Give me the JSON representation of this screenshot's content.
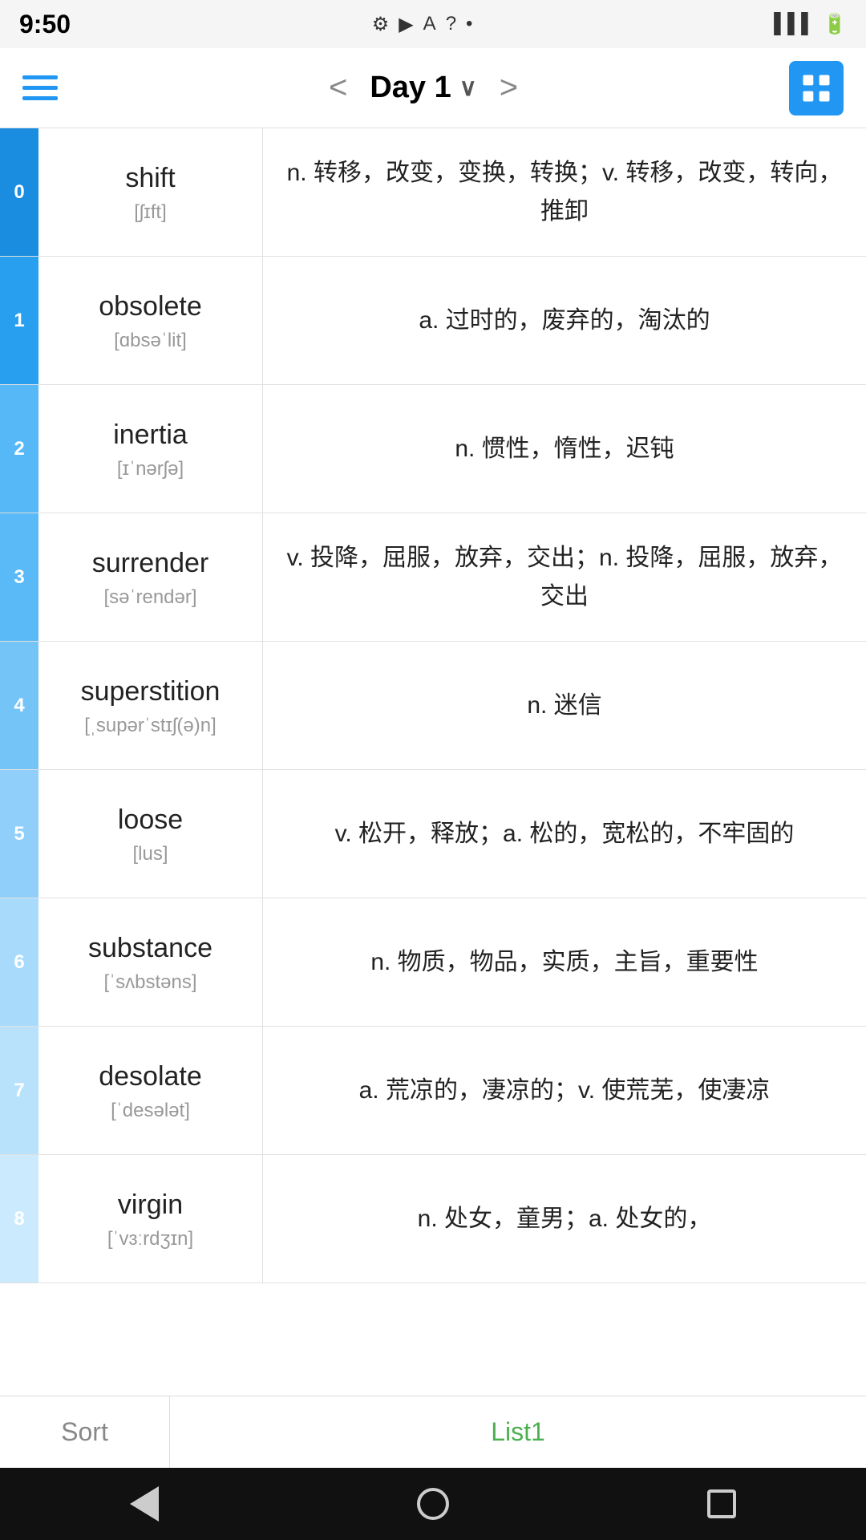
{
  "statusBar": {
    "time": "9:50",
    "icons": [
      "⚙",
      "▶",
      "A",
      "?",
      "•"
    ]
  },
  "navBar": {
    "prevLabel": "<",
    "nextLabel": ">",
    "title": "Day 1",
    "chevron": "∨"
  },
  "words": [
    {
      "index": "0",
      "english": "shift",
      "phonetic": "[ʃɪft]",
      "definition": "n. 转移，改变，变换，转换；v. 转移，改变，转向，推卸"
    },
    {
      "index": "1",
      "english": "obsolete",
      "phonetic": "[ɑbsəˈlit]",
      "definition": "a. 过时的，废弃的，淘汰的"
    },
    {
      "index": "2",
      "english": "inertia",
      "phonetic": "[ɪˈnərʃə]",
      "definition": "n. 惯性，惰性，迟钝"
    },
    {
      "index": "3",
      "english": "surrender",
      "phonetic": "[səˈrendər]",
      "definition": "v. 投降，屈服，放弃，交出；n. 投降，屈服，放弃，交出"
    },
    {
      "index": "4",
      "english": "superstition",
      "phonetic": "[ˌsupərˈstɪʃ(ə)n]",
      "definition": "n. 迷信"
    },
    {
      "index": "5",
      "english": "loose",
      "phonetic": "[lus]",
      "definition": "v. 松开，释放；a. 松的，宽松的，不牢固的"
    },
    {
      "index": "6",
      "english": "substance",
      "phonetic": "[ˈsʌbstəns]",
      "definition": "n. 物质，物品，实质，主旨，重要性"
    },
    {
      "index": "7",
      "english": "desolate",
      "phonetic": "[ˈdesələt]",
      "definition": "a. 荒凉的，凄凉的；v. 使荒芜，使凄凉"
    },
    {
      "index": "8",
      "english": "virgin",
      "phonetic": "[ˈvɜːrdʒɪn]",
      "definition": "n. 处女，童男；a. 处女的，"
    }
  ],
  "bottomTabs": {
    "sortLabel": "Sort",
    "list1Label": "List1"
  },
  "androidNav": {
    "back": "back",
    "home": "home",
    "recent": "recent"
  }
}
